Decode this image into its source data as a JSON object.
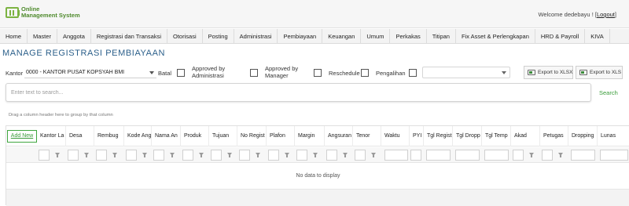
{
  "app": {
    "logo_line1": "Online",
    "logo_line2": "Management System",
    "welcome_text": "Welcome dedebayu ! [",
    "logout_label": "Logout",
    "welcome_close": "]"
  },
  "menu": [
    "Home",
    "Master",
    "Anggota",
    "Registrasi dan Transaksi",
    "Otorisasi",
    "Posting",
    "Administrasi",
    "Pembiayaan",
    "Keuangan",
    "Umum",
    "Perkakas",
    "Titipan",
    "Fix Asset & Perlengkapan",
    "HRD & Payroll",
    "KIVA"
  ],
  "page_title": "MANAGE REGISTRASI PEMBIAYAAN",
  "filters": {
    "kantor_label": "Kantor",
    "kantor_value": "0000 - KANTOR PUSAT KOPSYAH BMI",
    "batal_label": "Batal",
    "approved_admin_label": "Approved by Administrasi",
    "approved_manager_label": "Approved by Manager",
    "reschedule_label": "Reschedule",
    "pengalihan_label": "Pengalihan",
    "pengalihan_value": "",
    "export_xlsx_label": "Export to XLSX",
    "export_xls_label": "Export to XLS"
  },
  "search": {
    "placeholder": "Enter text to search...",
    "button_label": "Search"
  },
  "grid": {
    "group_hint": "Drag a column header here to group by that column",
    "add_new_label": "Add New",
    "columns": [
      "Kantor La",
      "Desa",
      "Rembug",
      "Kode Ang",
      "Nama An",
      "Produk",
      "Tujuan",
      "No Regist",
      "Plafon",
      "Margin",
      "Angsuran",
      "Tenor",
      "Waktu",
      "PYI",
      "Tgl Regist",
      "Tgl Dropp",
      "Tgl Temp",
      "Akad",
      "Petugas",
      "Dropping",
      "Lunas"
    ],
    "empty_text": "No data to display"
  }
}
